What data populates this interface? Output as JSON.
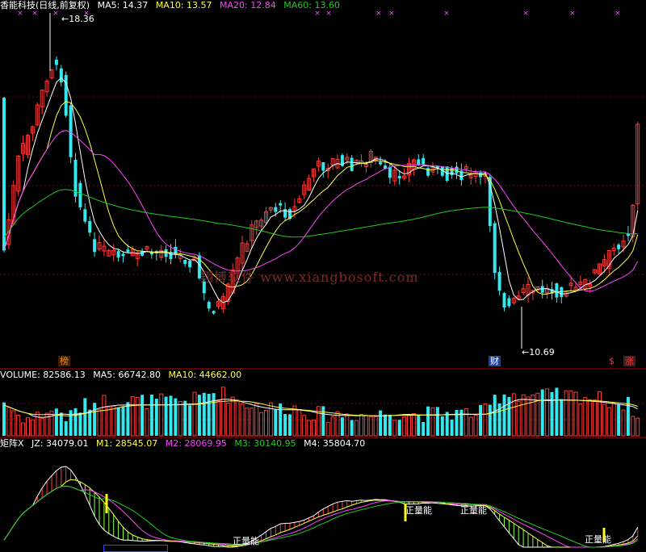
{
  "header": {
    "title": "香能科技(日线,前复权)",
    "ma5": "MA5: 14.37",
    "ma10": "MA10: 13.57",
    "ma20": "MA20: 12.84",
    "ma60": "MA60: 13.60"
  },
  "price_panel": {
    "high_label": "18.36",
    "low_label": "10.69",
    "watermark": "翔博软件 www.xiangbosoft.com",
    "badges": {
      "bang": "榜",
      "cai": "财",
      "dollar": "$",
      "zhang": "涨"
    }
  },
  "volume_header": {
    "volume": "VOLUME: 82586.13",
    "ma5": "MA5: 66742.80",
    "ma10": "MA10: 44662.00"
  },
  "indicator_header": {
    "name": "矩阵X",
    "jz": "JZ: 34079.01",
    "m1": "M1: 28545.07",
    "m2": "M2: 28069.95",
    "m3": "M3: 30140.95",
    "m4": "M4: 35804.70"
  },
  "indicator_signals": {
    "s1": "正量能",
    "s2": "正量能",
    "s3": "正量能",
    "s4": "正量能"
  },
  "colors": {
    "up": "#ff3a3a",
    "down": "#34e8ee",
    "ma5": "#ffffff",
    "ma10": "#ffff44",
    "ma20": "#ff44ff",
    "ma60": "#22cc22",
    "separator": "#b00000"
  }
}
